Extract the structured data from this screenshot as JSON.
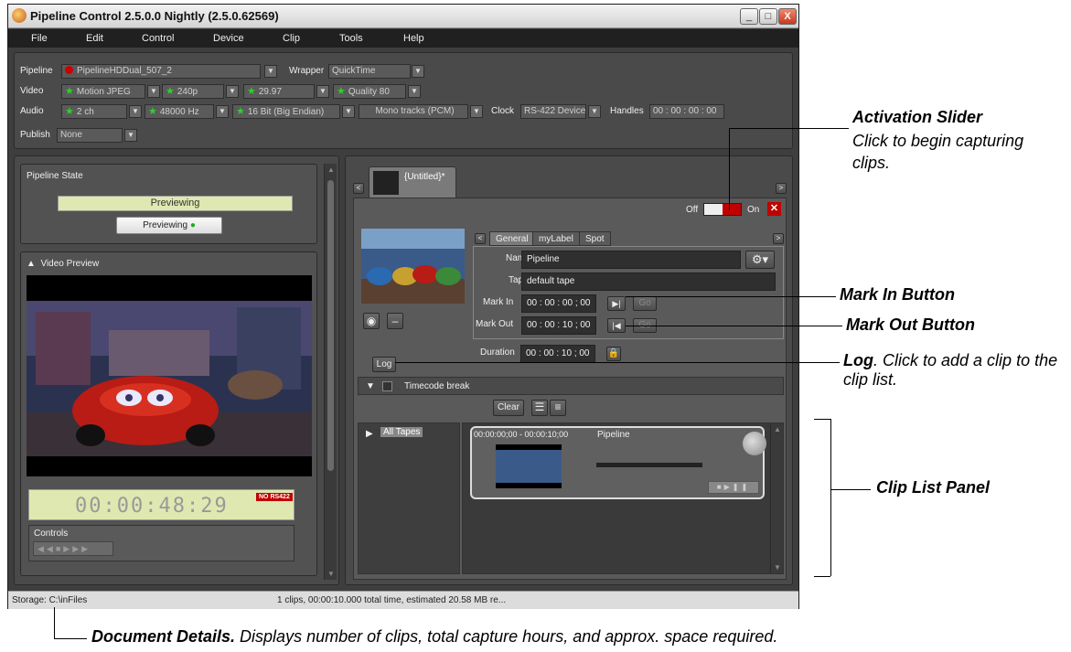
{
  "window": {
    "title": "Pipeline Control 2.5.0.0 Nightly (2.5.0.62569)",
    "min_btn": "_",
    "max_btn": "□",
    "close_btn": "X"
  },
  "menu": [
    "File",
    "Edit",
    "Control",
    "Device",
    "Clip",
    "Tools",
    "Help"
  ],
  "settings": {
    "pipeline_label": "Pipeline",
    "pipeline_value": "PipelineHDDual_507_2",
    "wrapper_label": "Wrapper",
    "wrapper_value": "QuickTime",
    "video_label": "Video",
    "video_codec": "Motion JPEG",
    "video_size": "240p",
    "video_rate": "29.97",
    "video_quality": "Quality 80",
    "audio_label": "Audio",
    "audio_ch": "2  ch",
    "audio_rate": "48000  Hz",
    "audio_bits": "16 Bit (Big Endian)",
    "audio_tracks": "Mono tracks (PCM)",
    "clock_label": "Clock",
    "clock_value": "RS-422 Device",
    "handles_label": "Handles",
    "handles_value": "00 : 00 : 00 : 00",
    "publish_label": "Publish",
    "publish_value": "None"
  },
  "left": {
    "state_title": "Pipeline State",
    "state_value": "Previewing",
    "state_button": "Previewing",
    "preview_title": "Video Preview",
    "timecode": "00:00:48:29",
    "no_rs422": "NO RS422",
    "controls_title": "Controls"
  },
  "doc": {
    "tab_label": "{Untitled}*",
    "off_label": "Off",
    "on_label": "On",
    "tabs": [
      "General",
      "myLabel",
      "Spot"
    ],
    "name_label": "Name",
    "name_value": "Pipeline",
    "tape_label": "Tape",
    "tape_value": "default tape",
    "markin_label": "Mark In",
    "markin_value": "00 : 00 : 00 ; 00",
    "markout_label": "Mark Out",
    "markout_value": "00 : 00 : 10 ; 00",
    "duration_label": "Duration",
    "duration_value": "00 : 00 : 10 ; 00",
    "go_label": "Go",
    "log_button": "Log",
    "timecode_break": "Timecode break",
    "clear_button": "Clear",
    "all_tapes": "All Tapes",
    "clip_range": "00:00:00;00  -  00:00:10;00",
    "clip_name": "Pipeline"
  },
  "status": {
    "storage": "Storage: C:\\inFiles",
    "details": "1 clips, 00:00:10.000 total time, estimated 20.58 MB re..."
  },
  "callouts": {
    "activation_title": "Activation Slider",
    "activation_text": "Click to begin capturing clips.",
    "markin": "Mark In Button",
    "markout": "Mark Out Button",
    "log_title": "Log",
    "log_text": ". Click to add a clip to the clip list.",
    "cliplist": "Clip List Panel",
    "docdetails_title": "Document Details.",
    "docdetails_text": " Displays number of clips, total capture hours, and approx. space required."
  },
  "colors": {
    "accent_red": "#c00000",
    "state_bar": "#dfe8b0",
    "green_star": "#33cc33"
  }
}
